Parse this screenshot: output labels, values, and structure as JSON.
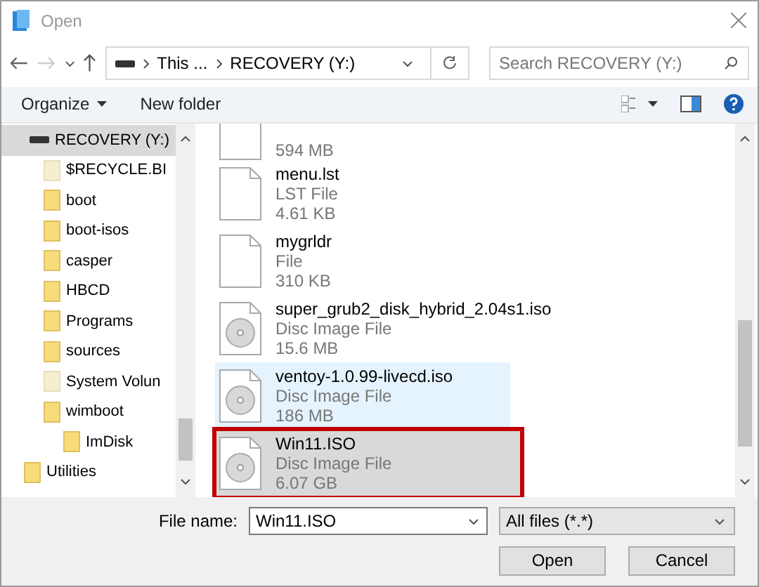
{
  "window": {
    "title": "Open"
  },
  "address": {
    "crumbs": [
      "This ...",
      "RECOVERY (Y:)"
    ],
    "search_placeholder": "Search RECOVERY (Y:)"
  },
  "toolbar": {
    "organize": "Organize",
    "new_folder": "New folder"
  },
  "sidebar": {
    "items": [
      {
        "label": "RECOVERY (Y:)",
        "kind": "drive",
        "selected": true,
        "children": [
          {
            "label": "$RECYCLE.BI",
            "kind": "hidden-folder",
            "selected": false
          },
          {
            "label": "boot",
            "kind": "folder",
            "selected": false
          },
          {
            "label": "boot-isos",
            "kind": "folder",
            "selected": false
          },
          {
            "label": "casper",
            "kind": "folder",
            "selected": false
          },
          {
            "label": "HBCD",
            "kind": "folder",
            "selected": false
          },
          {
            "label": "Programs",
            "kind": "folder",
            "selected": false
          },
          {
            "label": "sources",
            "kind": "folder",
            "selected": false
          },
          {
            "label": "System Volun",
            "kind": "hidden-folder",
            "selected": false
          },
          {
            "label": "wimboot",
            "kind": "folder",
            "selected": false,
            "children": [
              {
                "label": "ImDisk",
                "kind": "folder",
                "selected": false
              }
            ]
          }
        ]
      },
      {
        "label": "Utilities",
        "kind": "folder",
        "selected": false
      }
    ]
  },
  "files": [
    {
      "size": "594 MB",
      "kind": "file",
      "hovered": false,
      "selected": false
    },
    {
      "name": "menu.lst",
      "type": "LST File",
      "size": "4.61 KB",
      "kind": "file",
      "hovered": false,
      "selected": false
    },
    {
      "name": "mygrldr",
      "type": "File",
      "size": "310 KB",
      "kind": "file",
      "hovered": false,
      "selected": false
    },
    {
      "name": "super_grub2_disk_hybrid_2.04s1.iso",
      "type": "Disc Image File",
      "size": "15.6 MB",
      "kind": "disc",
      "hovered": false,
      "selected": false
    },
    {
      "name": "ventoy-1.0.99-livecd.iso",
      "type": "Disc Image File",
      "size": "186 MB",
      "kind": "disc",
      "hovered": true,
      "selected": false
    },
    {
      "name": "Win11.ISO",
      "type": "Disc Image File",
      "size": "6.07 GB",
      "kind": "disc",
      "hovered": false,
      "selected": true
    }
  ],
  "bottom": {
    "file_name_label": "File name:",
    "file_name": "Win11.ISO",
    "file_type": "All files (*.*)",
    "buttons": [
      "Open",
      "Cancel"
    ]
  }
}
